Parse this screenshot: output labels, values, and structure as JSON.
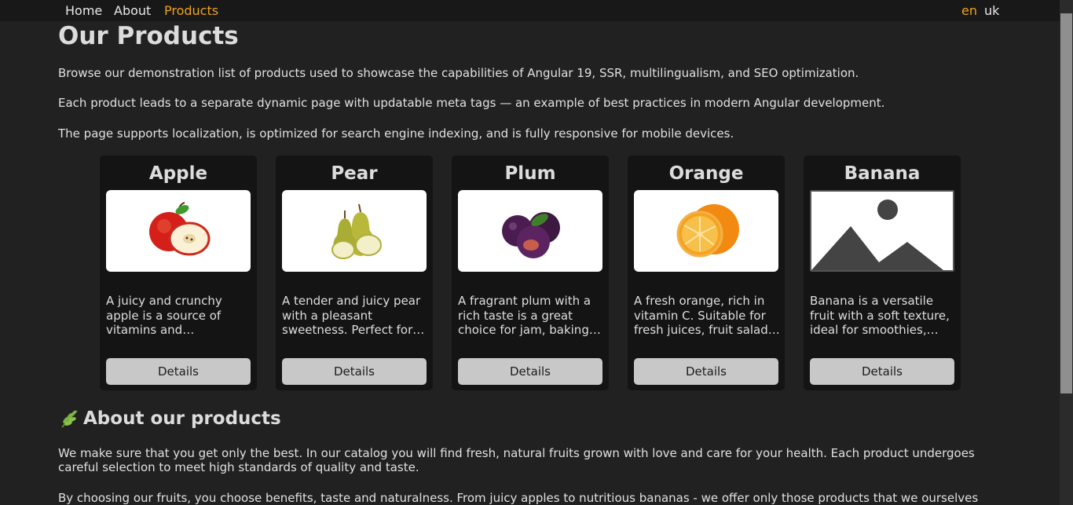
{
  "nav": {
    "links": [
      "Home",
      "About",
      "Products"
    ],
    "active": "Products",
    "languages": [
      "en",
      "uk"
    ],
    "active_language": "en"
  },
  "header": {
    "title": "Our Products"
  },
  "intro": [
    "Browse our demonstration list of products used to showcase the capabilities of Angular 19, SSR, multilingualism, and SEO optimization.",
    "Each product leads to a separate dynamic page with updatable meta tags — an example of best practices in modern Angular development.",
    "The page supports localization, is optimized for search engine indexing, and is fully responsive for mobile devices."
  ],
  "products": [
    {
      "name": "Apple",
      "icon": "apple-image",
      "description": "A juicy and crunchy apple is a source of vitamins and antioxidants. Perfect for snacks, salads and desserts.",
      "button": "Details"
    },
    {
      "name": "Pear",
      "icon": "pear-image",
      "description": "A tender and juicy pear with a pleasant sweetness. Perfect for desserts and fresh salads.",
      "button": "Details"
    },
    {
      "name": "Plum",
      "icon": "plum-image",
      "description": "A fragrant plum with a rich taste is a great choice for jam, baking and snacks.",
      "button": "Details"
    },
    {
      "name": "Orange",
      "icon": "orange-image",
      "description": "A fresh orange, rich in vitamin C. Suitable for fresh juices, fruit salads and desserts.",
      "button": "Details"
    },
    {
      "name": "Banana",
      "icon": "image-placeholder",
      "description": "Banana is a versatile fruit with a soft texture, ideal for smoothies, desserts and snacks.",
      "button": "Details"
    }
  ],
  "about": {
    "icon": "herb-icon",
    "title": "About our products",
    "paragraphs": [
      "We make sure that you get only the best. In our catalog you will find fresh, natural fruits grown with love and care for your health. Each product undergoes careful selection to meet high standards of quality and taste.",
      "By choosing our fruits, you choose benefits, taste and naturalness. From juicy apples to nutritious bananas - we offer only those products that we ourselves consume"
    ]
  },
  "colors": {
    "background": "#212121",
    "navbar": "#181818",
    "card": "#141414",
    "accent": "#f0a21c",
    "button": "#c8c8c8"
  }
}
